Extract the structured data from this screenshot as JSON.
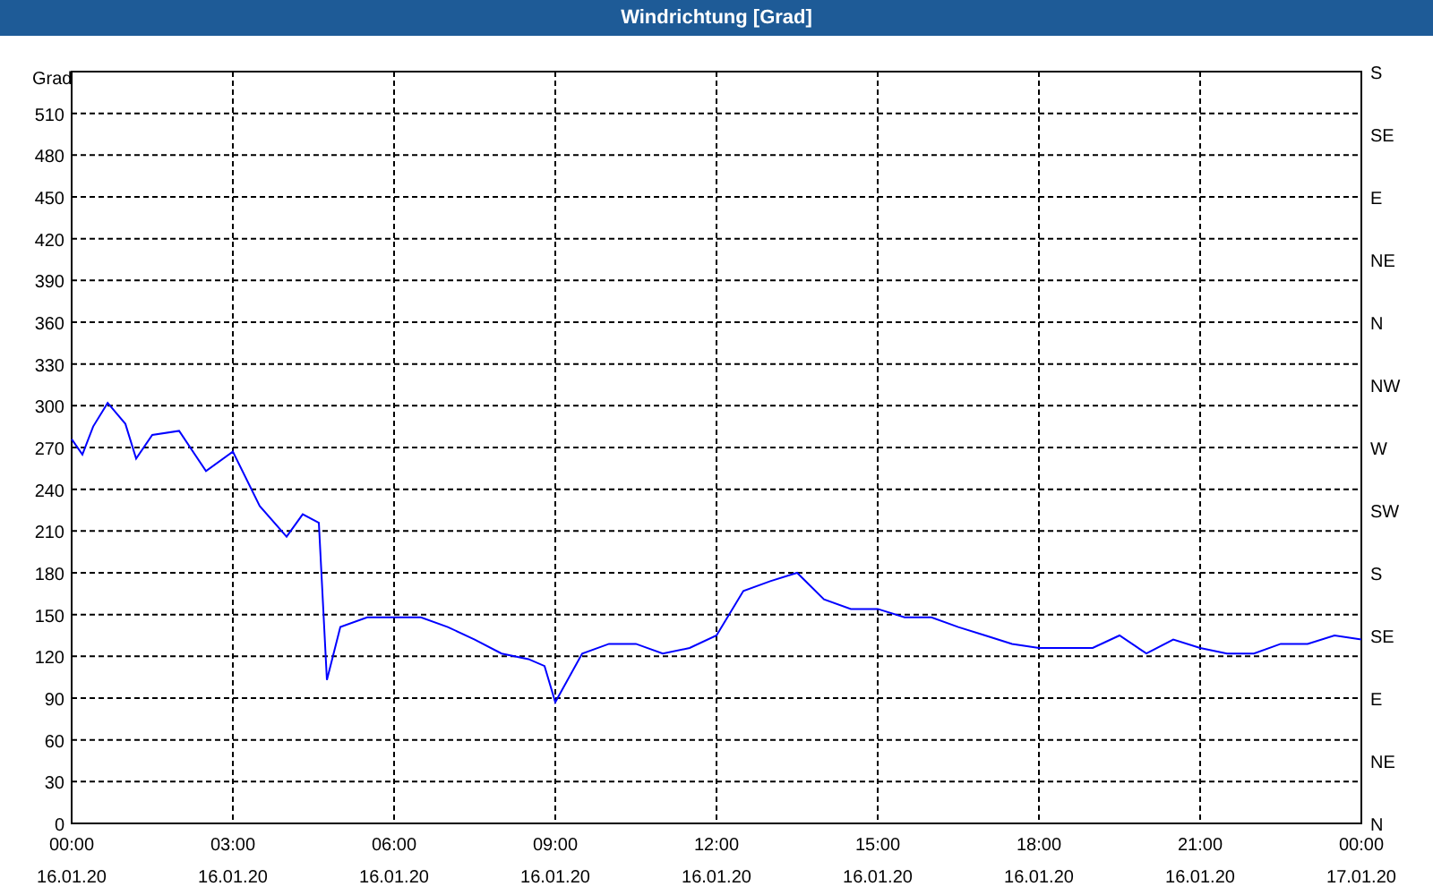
{
  "window": {
    "title": "Windrichtung [Grad]"
  },
  "chart": {
    "chart_data": {
      "type": "line",
      "ylabel": "Grad",
      "grid": true,
      "xlim": [
        0,
        24
      ],
      "ylim": [
        0,
        540
      ],
      "xticks": [
        {
          "value": 0,
          "label": "00:00"
        },
        {
          "value": 3,
          "label": "03:00"
        },
        {
          "value": 6,
          "label": "06:00"
        },
        {
          "value": 9,
          "label": "09:00"
        },
        {
          "value": 12,
          "label": "12:00"
        },
        {
          "value": 15,
          "label": "15:00"
        },
        {
          "value": 18,
          "label": "18:00"
        },
        {
          "value": 21,
          "label": "21:00"
        },
        {
          "value": 24,
          "label": "00:00"
        }
      ],
      "yticks": [
        0,
        30,
        60,
        90,
        120,
        150,
        180,
        210,
        240,
        270,
        300,
        330,
        360,
        390,
        420,
        450,
        480,
        510
      ],
      "x": [
        0,
        0.2,
        0.4,
        0.67,
        1,
        1.2,
        1.5,
        2,
        2.5,
        3,
        3.5,
        4,
        4.3,
        4.6,
        4.75,
        5,
        5.5,
        6,
        6.5,
        7,
        7.5,
        8,
        8.5,
        8.8,
        9,
        9.5,
        10,
        10.5,
        11,
        11.5,
        12,
        12.5,
        13,
        13.5,
        14,
        14.5,
        15,
        15.5,
        16,
        16.5,
        17,
        17.5,
        18,
        18.5,
        19,
        19.5,
        20,
        20.5,
        21,
        21.5,
        22,
        22.5,
        23,
        23.5,
        24
      ],
      "series": [
        {
          "color": "#0000ff",
          "values": [
            276,
            265,
            285,
            302,
            287,
            262,
            279,
            282,
            253,
            267,
            228,
            206,
            222,
            216,
            103,
            141,
            148,
            148,
            148,
            141,
            132,
            122,
            118,
            113,
            87,
            122,
            129,
            129,
            122,
            126,
            135,
            167,
            174,
            180,
            161,
            154,
            154,
            148,
            148,
            141,
            135,
            129,
            126,
            126,
            126,
            135,
            122,
            132,
            126,
            122,
            122,
            129,
            129,
            135,
            132
          ]
        }
      ]
    },
    "x_dates": [
      "16.01.20",
      "16.01.20",
      "16.01.20",
      "16.01.20",
      "16.01.20",
      "16.01.20",
      "16.01.20",
      "16.01.20",
      "17.01.20"
    ],
    "right_axis_labels": [
      "S",
      "SE",
      "E",
      "NE",
      "N",
      "NW",
      "W",
      "SW",
      "S",
      "SE",
      "E",
      "NE",
      "N"
    ]
  }
}
